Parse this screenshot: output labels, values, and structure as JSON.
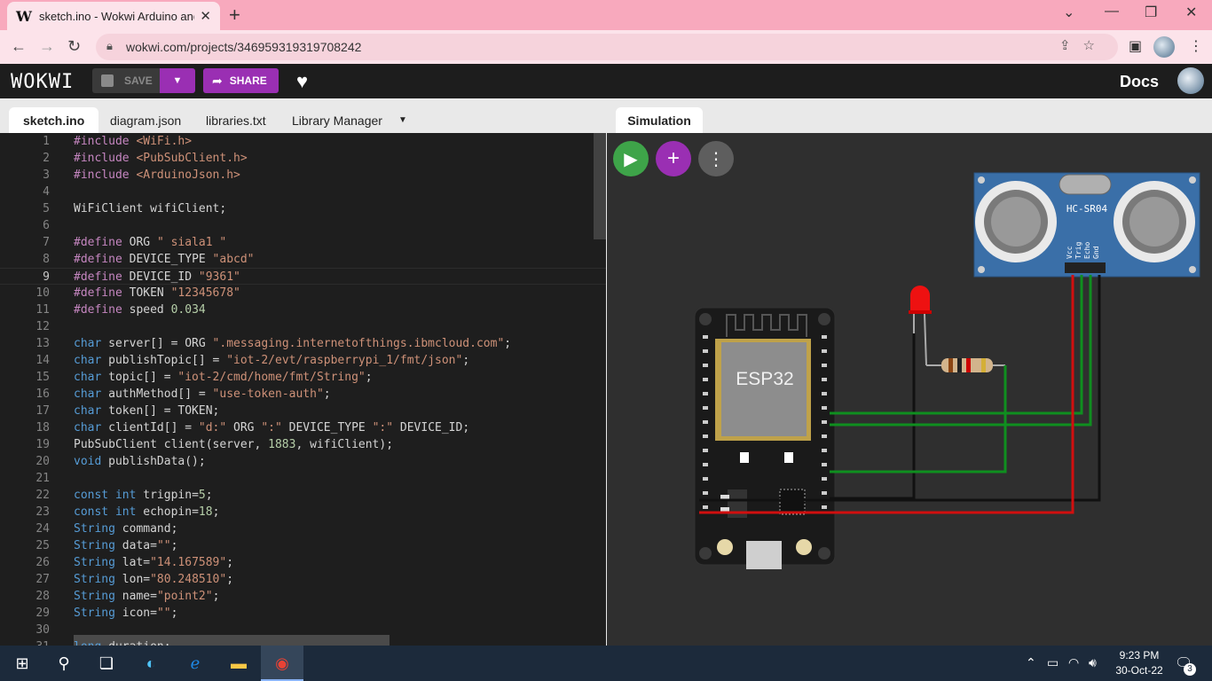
{
  "browser": {
    "tab_title": "sketch.ino - Wokwi Arduino and E",
    "favicon": "W",
    "url": "wokwi.com/projects/346959319319708242"
  },
  "wokwi": {
    "logo": "WOKWI",
    "save_label": "SAVE",
    "share_label": "SHARE",
    "docs_label": "Docs"
  },
  "editor": {
    "tabs": [
      "sketch.ino",
      "diagram.json",
      "libraries.txt",
      "Library Manager"
    ],
    "current_line": 9,
    "lines": [
      "#include <WiFi.h>",
      "#include <PubSubClient.h>",
      "#include <ArduinoJson.h>",
      "",
      "WiFiClient wifiClient;",
      "",
      "#define ORG \" siala1 \"",
      "#define DEVICE_TYPE \"abcd\"",
      "#define DEVICE_ID \"9361\"",
      "#define TOKEN \"12345678\"",
      "#define speed 0.034",
      "",
      "char server[] = ORG \".messaging.internetofthings.ibmcloud.com\";",
      "char publishTopic[] = \"iot-2/evt/raspberrypi_1/fmt/json\";",
      "char topic[] = \"iot-2/cmd/home/fmt/String\";",
      "char authMethod[] = \"use-token-auth\";",
      "char token[] = TOKEN;",
      "char clientId[] = \"d:\" ORG \":\" DEVICE_TYPE \":\" DEVICE_ID;",
      "PubSubClient client(server, 1883, wifiClient);",
      "void publishData();",
      "",
      "const int trigpin=5;",
      "const int echopin=18;",
      "String command;",
      "String data=\"\";",
      "String lat=\"14.167589\";",
      "String lon=\"80.248510\";",
      "String name=\"point2\";",
      "String icon=\"\";",
      "",
      "long duration;"
    ]
  },
  "simulation": {
    "tab_label": "Simulation",
    "esp32_label": "ESP32",
    "sensor_label": "HC-SR04",
    "sensor_pins": [
      "Vcc",
      "Trig",
      "Echo",
      "Gnd"
    ],
    "wire_colors": {
      "green": "#0f8f1f",
      "black": "#111111",
      "red": "#d10f0f"
    }
  },
  "taskbar": {
    "time": "9:23 PM",
    "date": "30-Oct-22",
    "notification_count": "3"
  },
  "colors": {
    "accent_purple": "#9a2fb3",
    "play_green": "#3ea449",
    "chrome_tab": "#f8a9bd"
  }
}
